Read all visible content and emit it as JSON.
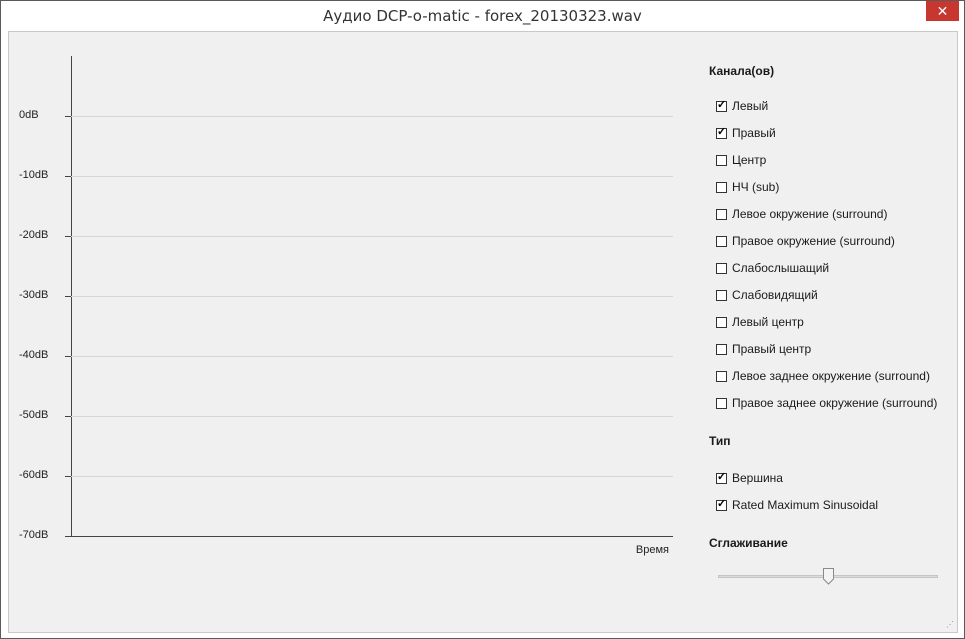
{
  "window": {
    "title": "Аудио DCP-o-matic  - forex_20130323.wav",
    "close_glyph": "✕"
  },
  "plot": {
    "y_labels": [
      "0dB",
      "-10dB",
      "-20dB",
      "-30dB",
      "-40dB",
      "-50dB",
      "-60dB",
      "-70dB"
    ],
    "x_label": "Время"
  },
  "chart_data": {
    "type": "line",
    "series": [],
    "ylabel": "",
    "xlabel": "Время",
    "ylim": [
      -70,
      0
    ],
    "yticks": [
      "0dB",
      "-10dB",
      "-20dB",
      "-30dB",
      "-40dB",
      "-50dB",
      "-60dB",
      "-70dB"
    ],
    "grid": true
  },
  "channels": {
    "heading": "Канала(ов)",
    "items": [
      {
        "label": "Левый",
        "checked": true
      },
      {
        "label": "Правый",
        "checked": true
      },
      {
        "label": "Центр",
        "checked": false
      },
      {
        "label": "НЧ (sub)",
        "checked": false
      },
      {
        "label": "Левое окружение (surround)",
        "checked": false
      },
      {
        "label": "Правое окружение (surround)",
        "checked": false
      },
      {
        "label": "Слабослышащий",
        "checked": false
      },
      {
        "label": "Слабовидящий",
        "checked": false
      },
      {
        "label": "Левый центр",
        "checked": false
      },
      {
        "label": "Правый центр",
        "checked": false
      },
      {
        "label": "Левое заднее окружение (surround)",
        "checked": false
      },
      {
        "label": "Правое заднее окружение (surround)",
        "checked": false
      }
    ]
  },
  "type": {
    "heading": "Тип",
    "items": [
      {
        "label": "Вершина",
        "checked": true
      },
      {
        "label": "Rated Maximum Sinusoidal",
        "checked": true
      }
    ]
  },
  "smoothing": {
    "heading": "Сглаживание",
    "value": 0.5
  }
}
